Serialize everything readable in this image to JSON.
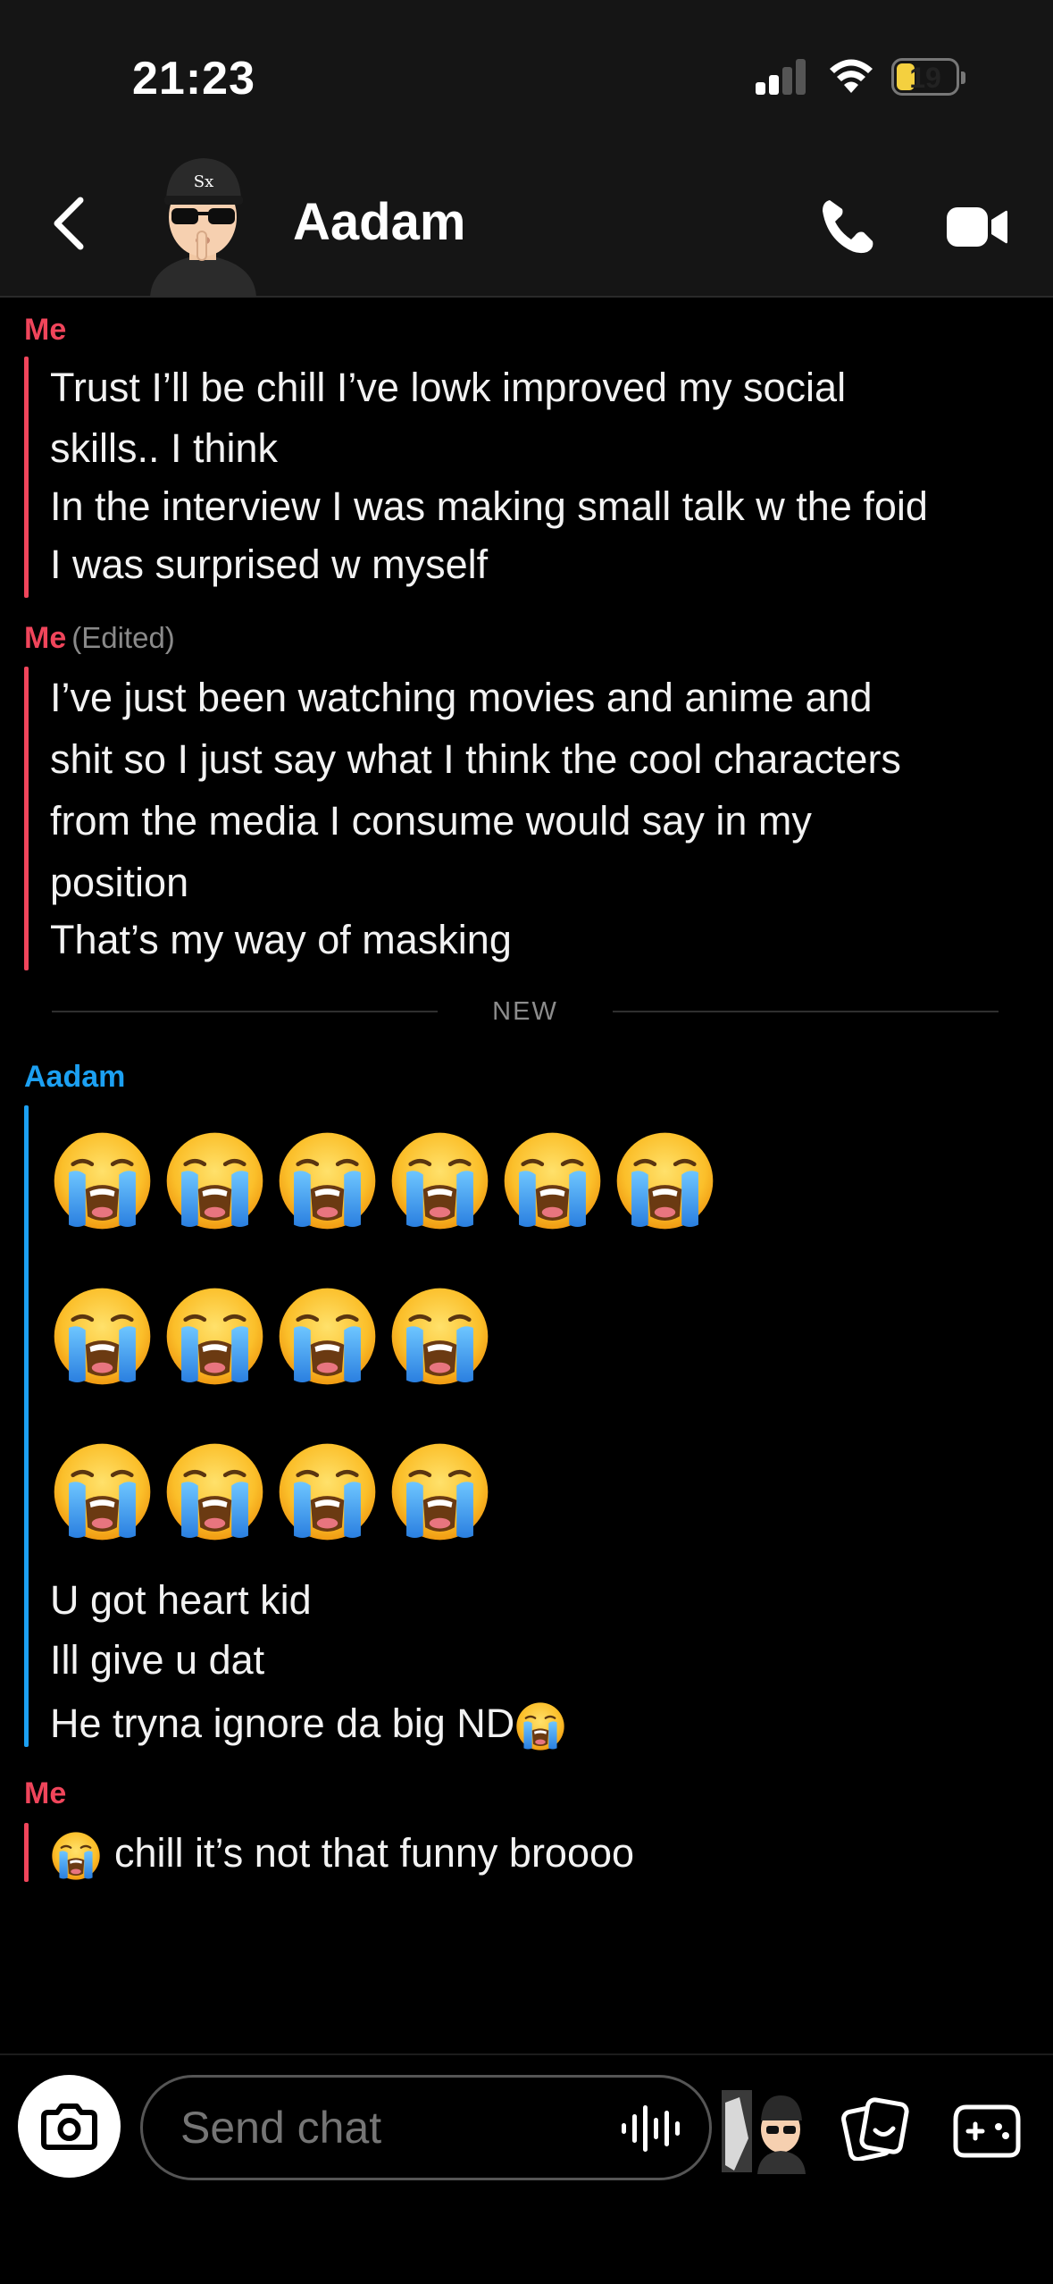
{
  "status_bar": {
    "time": "21:23",
    "battery": "19"
  },
  "header": {
    "contact_name": "Aadam"
  },
  "divider": {
    "label": "NEW"
  },
  "messages": [
    {
      "sender": "Me",
      "lines": [
        "Trust I’ll be chill I’ve lowk improved my social",
        "skills.. I think",
        "In the interview I was making small talk w the foid",
        "I was surprised w myself"
      ]
    },
    {
      "sender": "Me",
      "edited": "(Edited)",
      "lines": [
        "I’ve just been watching movies and anime and",
        "shit so I just say what I think the cool characters",
        "from the media I consume would say in my",
        "position",
        "That’s my way of masking"
      ]
    },
    {
      "sender": "Aadam",
      "emoji_rows": [
        6,
        4,
        4
      ],
      "emoji": "loudly-crying-face",
      "lines": [
        "U got heart kid",
        "Ill give u dat",
        "He tryna ignore da big ND"
      ]
    },
    {
      "sender": "Me",
      "lines": [
        "chill it’s not that funny broooo"
      ]
    }
  ],
  "composer": {
    "placeholder": "Send chat"
  },
  "colors": {
    "me": "#f0455b",
    "them": "#1ca0f2",
    "background": "#000000",
    "header": "#151515"
  }
}
